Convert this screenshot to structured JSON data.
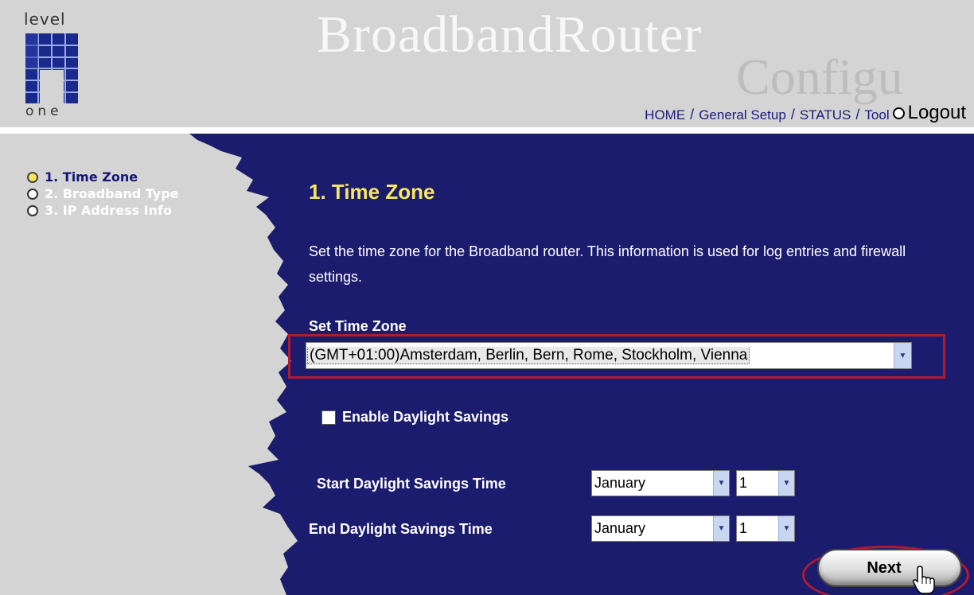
{
  "header": {
    "logo_top": "level",
    "logo_bottom": "one",
    "brand_title": "BroadbandRouter",
    "brand_sub": "Configu",
    "nav": [
      {
        "label": "HOME"
      },
      {
        "label": "General Setup"
      },
      {
        "label": "STATUS"
      },
      {
        "label": "Tool"
      }
    ],
    "logout_label": "Logout"
  },
  "sidebar": {
    "items": [
      {
        "label": "1. Time Zone",
        "active": true
      },
      {
        "label": "2. Broadband Type",
        "active": false
      },
      {
        "label": "3. IP Address Info",
        "active": false
      }
    ]
  },
  "main": {
    "title": "1. Time Zone",
    "description": "Set the time zone for the Broadband router. This information is used for log entries and firewall settings.",
    "time_zone_label": "Set Time Zone",
    "time_zone_value": "(GMT+01:00)Amsterdam, Berlin, Bern, Rome, Stockholm, Vienna",
    "daylight_label": "Enable Daylight Savings",
    "daylight_checked": false,
    "start_label": "Start Daylight Savings Time",
    "start_month": "January",
    "start_day": "1",
    "end_label": "End Daylight Savings Time",
    "end_month": "January",
    "end_day": "1",
    "next_label": "Next"
  },
  "colors": {
    "header_bg": "#d4d4d4",
    "content_bg": "#1c1c6e",
    "title": "#f7e85c",
    "highlight": "#b31a2f",
    "nav_link": "#1a1a80"
  }
}
